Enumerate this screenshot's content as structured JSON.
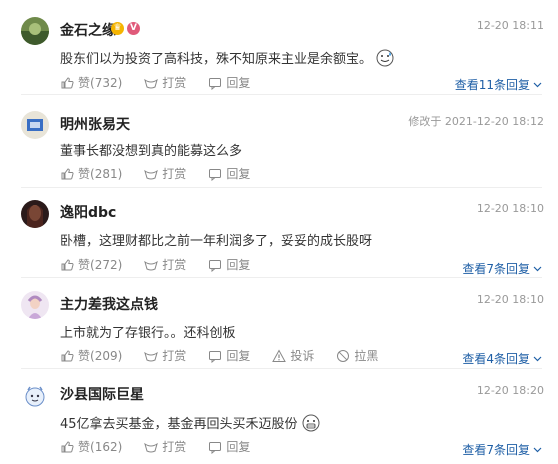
{
  "actions": {
    "like": "赞",
    "tip": "打赏",
    "reply": "回复",
    "report": "投诉",
    "block": "拉黑"
  },
  "comments": [
    {
      "username": "金石之缘",
      "badges": [
        "crown-badge",
        "v-badge"
      ],
      "time": "12-20 18:11",
      "text": "股东们以为投资了高科技，殊不知原来主业是余额宝。",
      "emoji": "grin-sweat-emoji",
      "likes": "(732)",
      "replies": "查看11条回复"
    },
    {
      "username": "明州张易天",
      "time": "修改于 2021-12-20 18:12",
      "text": "董事长都没想到真的能募这么多",
      "likes": "(281)"
    },
    {
      "username": "逸阳dbc",
      "time": "12-20 18:10",
      "text": "卧槽，这理财都比之前一年利润多了，妥妥的成长股呀",
      "likes": "(272)",
      "replies": "查看7条回复"
    },
    {
      "username": "主力差我这点钱",
      "time": "12-20 18:10",
      "text": "上市就为了存银行。。还科创板",
      "likes": "(209)",
      "replies": "查看4条回复"
    },
    {
      "username": "沙县国际巨星",
      "time": "12-20 18:20",
      "text": "45亿拿去买基金，基金再回头买禾迈股份",
      "emoji": "grin-emoji",
      "likes": "(162)",
      "replies": "查看7条回复"
    }
  ]
}
